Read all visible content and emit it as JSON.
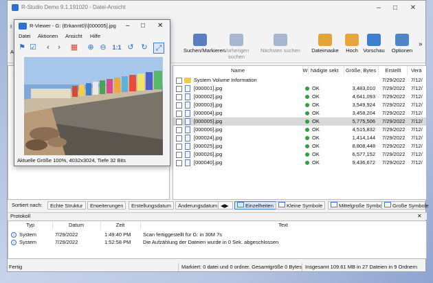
{
  "main_window": {
    "title": "R-Studio Demo 9.1.191020 - Datei-Ansicht",
    "menu_left": "Li",
    "toolbar_left": "Al"
  },
  "toolbar": [
    {
      "label": "Suchen/Markieren",
      "icon": "binoculars-icon",
      "enabled": true
    },
    {
      "label": "Vorherigen suchen",
      "icon": "binoculars-prev-icon",
      "enabled": false
    },
    {
      "label": "Nächsten suchen",
      "icon": "binoculars-next-icon",
      "enabled": false
    },
    {
      "label": "Dateimaske",
      "icon": "file-mask-icon",
      "enabled": true
    },
    {
      "label": "Hoch",
      "icon": "folder-up-icon",
      "enabled": true
    },
    {
      "label": "Vorschau",
      "icon": "preview-icon",
      "enabled": true
    },
    {
      "label": "Optionen",
      "icon": "options-icon",
      "enabled": true
    }
  ],
  "toolbar_more": "»",
  "file_list": {
    "columns": [
      "Name",
      "W",
      "hädigte sekt",
      "Größe, Bytes",
      "Erstellt",
      "Verä"
    ],
    "rows": [
      {
        "name": "System Volume Information",
        "type": "folder",
        "status": "",
        "size": "",
        "created": "7/29/2022",
        "modified": "7/12/",
        "selected": false
      },
      {
        "name": "[000001].jpg",
        "type": "file",
        "status": "OK",
        "size": "3,483,010",
        "created": "7/29/2022",
        "modified": "7/12/",
        "selected": false
      },
      {
        "name": "[000002].jpg",
        "type": "file",
        "status": "OK",
        "size": "4,641,093",
        "created": "7/29/2022",
        "modified": "7/12/",
        "selected": false
      },
      {
        "name": "[000003].jpg",
        "type": "file",
        "status": "OK",
        "size": "3,549,924",
        "created": "7/29/2022",
        "modified": "7/12/",
        "selected": false
      },
      {
        "name": "[000004].jpg",
        "type": "file",
        "status": "OK",
        "size": "3,458,204",
        "created": "7/29/2022",
        "modified": "7/12/",
        "selected": false
      },
      {
        "name": "[000005].jpg",
        "type": "file",
        "status": "OK",
        "size": "5,775,506",
        "created": "7/29/2022",
        "modified": "7/12/",
        "selected": true
      },
      {
        "name": "[000006].jpg",
        "type": "file",
        "status": "OK",
        "size": "4,515,832",
        "created": "7/29/2022",
        "modified": "7/12/",
        "selected": false
      },
      {
        "name": "[000024].jpg",
        "type": "file",
        "status": "OK",
        "size": "1,414,144",
        "created": "7/29/2022",
        "modified": "7/12/",
        "selected": false
      },
      {
        "name": "[000025].jpg",
        "type": "file",
        "status": "OK",
        "size": "8,808,448",
        "created": "7/29/2022",
        "modified": "7/12/",
        "selected": false
      },
      {
        "name": "[000026].jpg",
        "type": "file",
        "status": "OK",
        "size": "6,577,152",
        "created": "7/29/2022",
        "modified": "7/12/",
        "selected": false
      },
      {
        "name": "[000040].jpg",
        "type": "file",
        "status": "OK",
        "size": "9,436,672",
        "created": "7/29/2022",
        "modified": "7/12/",
        "selected": false
      }
    ]
  },
  "sort_bar": {
    "label": "Sortiert nach:",
    "sort_options": [
      "Echte Struktur",
      "Erweiterungen",
      "Erstellungsdatum",
      "Änderungsdatum"
    ],
    "view_options": [
      {
        "label": "Einzelheiten",
        "active": true
      },
      {
        "label": "Kleine Symbole",
        "active": false
      },
      {
        "label": "Mittelgroße Symbole",
        "active": false
      },
      {
        "label": "Große Symbole",
        "active": false
      }
    ]
  },
  "protocol": {
    "title": "Protokoll",
    "columns": [
      "Typ",
      "Datum",
      "Zeit",
      "Text"
    ],
    "rows": [
      {
        "type": "System",
        "date": "7/29/2022",
        "time": "1:49:40 PM",
        "text": "Scan fertiggestellt für G: in 30M 7s"
      },
      {
        "type": "System",
        "date": "7/29/2022",
        "time": "1:52:58 PM",
        "text": "Die Aufzählung der Dateien wurde in 0 Sek. abgeschlossen"
      }
    ]
  },
  "status_bar": {
    "ready": "Fertig",
    "marked": "Markiert: 0 datei und 0 ordner. Gesamtgröße 0 Bytes",
    "total": "Insgesamt 109.61 MB in 27 Dateien in 9 Ordnern"
  },
  "viewer": {
    "title": "R-Viewer - G: (Erkannt0)\\[000005].jpg",
    "menu": [
      "Datei",
      "Aktionen",
      "Ansicht",
      "Hilfe"
    ],
    "zoom_label": "1:1",
    "status": "Aktuelle Größe 100%, 4032x3024, Tiefe 32 Bits"
  }
}
